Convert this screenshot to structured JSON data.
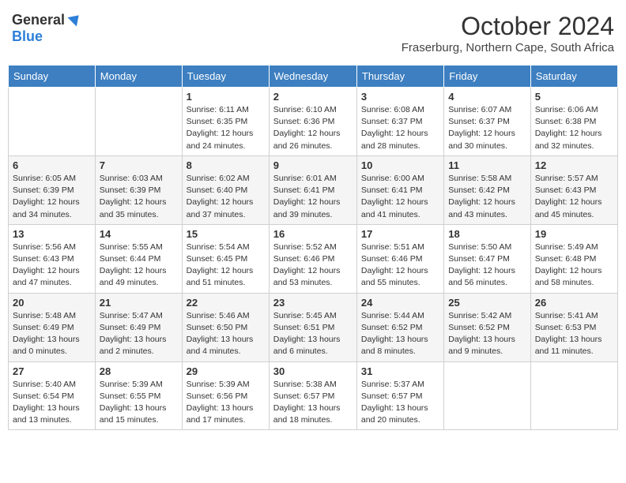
{
  "header": {
    "logo_general": "General",
    "logo_blue": "Blue",
    "month": "October 2024",
    "location": "Fraserburg, Northern Cape, South Africa"
  },
  "weekdays": [
    "Sunday",
    "Monday",
    "Tuesday",
    "Wednesday",
    "Thursday",
    "Friday",
    "Saturday"
  ],
  "weeks": [
    [
      {
        "day": "",
        "info": ""
      },
      {
        "day": "",
        "info": ""
      },
      {
        "day": "1",
        "info": "Sunrise: 6:11 AM\nSunset: 6:35 PM\nDaylight: 12 hours and 24 minutes."
      },
      {
        "day": "2",
        "info": "Sunrise: 6:10 AM\nSunset: 6:36 PM\nDaylight: 12 hours and 26 minutes."
      },
      {
        "day": "3",
        "info": "Sunrise: 6:08 AM\nSunset: 6:37 PM\nDaylight: 12 hours and 28 minutes."
      },
      {
        "day": "4",
        "info": "Sunrise: 6:07 AM\nSunset: 6:37 PM\nDaylight: 12 hours and 30 minutes."
      },
      {
        "day": "5",
        "info": "Sunrise: 6:06 AM\nSunset: 6:38 PM\nDaylight: 12 hours and 32 minutes."
      }
    ],
    [
      {
        "day": "6",
        "info": "Sunrise: 6:05 AM\nSunset: 6:39 PM\nDaylight: 12 hours and 34 minutes."
      },
      {
        "day": "7",
        "info": "Sunrise: 6:03 AM\nSunset: 6:39 PM\nDaylight: 12 hours and 35 minutes."
      },
      {
        "day": "8",
        "info": "Sunrise: 6:02 AM\nSunset: 6:40 PM\nDaylight: 12 hours and 37 minutes."
      },
      {
        "day": "9",
        "info": "Sunrise: 6:01 AM\nSunset: 6:41 PM\nDaylight: 12 hours and 39 minutes."
      },
      {
        "day": "10",
        "info": "Sunrise: 6:00 AM\nSunset: 6:41 PM\nDaylight: 12 hours and 41 minutes."
      },
      {
        "day": "11",
        "info": "Sunrise: 5:58 AM\nSunset: 6:42 PM\nDaylight: 12 hours and 43 minutes."
      },
      {
        "day": "12",
        "info": "Sunrise: 5:57 AM\nSunset: 6:43 PM\nDaylight: 12 hours and 45 minutes."
      }
    ],
    [
      {
        "day": "13",
        "info": "Sunrise: 5:56 AM\nSunset: 6:43 PM\nDaylight: 12 hours and 47 minutes."
      },
      {
        "day": "14",
        "info": "Sunrise: 5:55 AM\nSunset: 6:44 PM\nDaylight: 12 hours and 49 minutes."
      },
      {
        "day": "15",
        "info": "Sunrise: 5:54 AM\nSunset: 6:45 PM\nDaylight: 12 hours and 51 minutes."
      },
      {
        "day": "16",
        "info": "Sunrise: 5:52 AM\nSunset: 6:46 PM\nDaylight: 12 hours and 53 minutes."
      },
      {
        "day": "17",
        "info": "Sunrise: 5:51 AM\nSunset: 6:46 PM\nDaylight: 12 hours and 55 minutes."
      },
      {
        "day": "18",
        "info": "Sunrise: 5:50 AM\nSunset: 6:47 PM\nDaylight: 12 hours and 56 minutes."
      },
      {
        "day": "19",
        "info": "Sunrise: 5:49 AM\nSunset: 6:48 PM\nDaylight: 12 hours and 58 minutes."
      }
    ],
    [
      {
        "day": "20",
        "info": "Sunrise: 5:48 AM\nSunset: 6:49 PM\nDaylight: 13 hours and 0 minutes."
      },
      {
        "day": "21",
        "info": "Sunrise: 5:47 AM\nSunset: 6:49 PM\nDaylight: 13 hours and 2 minutes."
      },
      {
        "day": "22",
        "info": "Sunrise: 5:46 AM\nSunset: 6:50 PM\nDaylight: 13 hours and 4 minutes."
      },
      {
        "day": "23",
        "info": "Sunrise: 5:45 AM\nSunset: 6:51 PM\nDaylight: 13 hours and 6 minutes."
      },
      {
        "day": "24",
        "info": "Sunrise: 5:44 AM\nSunset: 6:52 PM\nDaylight: 13 hours and 8 minutes."
      },
      {
        "day": "25",
        "info": "Sunrise: 5:42 AM\nSunset: 6:52 PM\nDaylight: 13 hours and 9 minutes."
      },
      {
        "day": "26",
        "info": "Sunrise: 5:41 AM\nSunset: 6:53 PM\nDaylight: 13 hours and 11 minutes."
      }
    ],
    [
      {
        "day": "27",
        "info": "Sunrise: 5:40 AM\nSunset: 6:54 PM\nDaylight: 13 hours and 13 minutes."
      },
      {
        "day": "28",
        "info": "Sunrise: 5:39 AM\nSunset: 6:55 PM\nDaylight: 13 hours and 15 minutes."
      },
      {
        "day": "29",
        "info": "Sunrise: 5:39 AM\nSunset: 6:56 PM\nDaylight: 13 hours and 17 minutes."
      },
      {
        "day": "30",
        "info": "Sunrise: 5:38 AM\nSunset: 6:57 PM\nDaylight: 13 hours and 18 minutes."
      },
      {
        "day": "31",
        "info": "Sunrise: 5:37 AM\nSunset: 6:57 PM\nDaylight: 13 hours and 20 minutes."
      },
      {
        "day": "",
        "info": ""
      },
      {
        "day": "",
        "info": ""
      }
    ]
  ]
}
